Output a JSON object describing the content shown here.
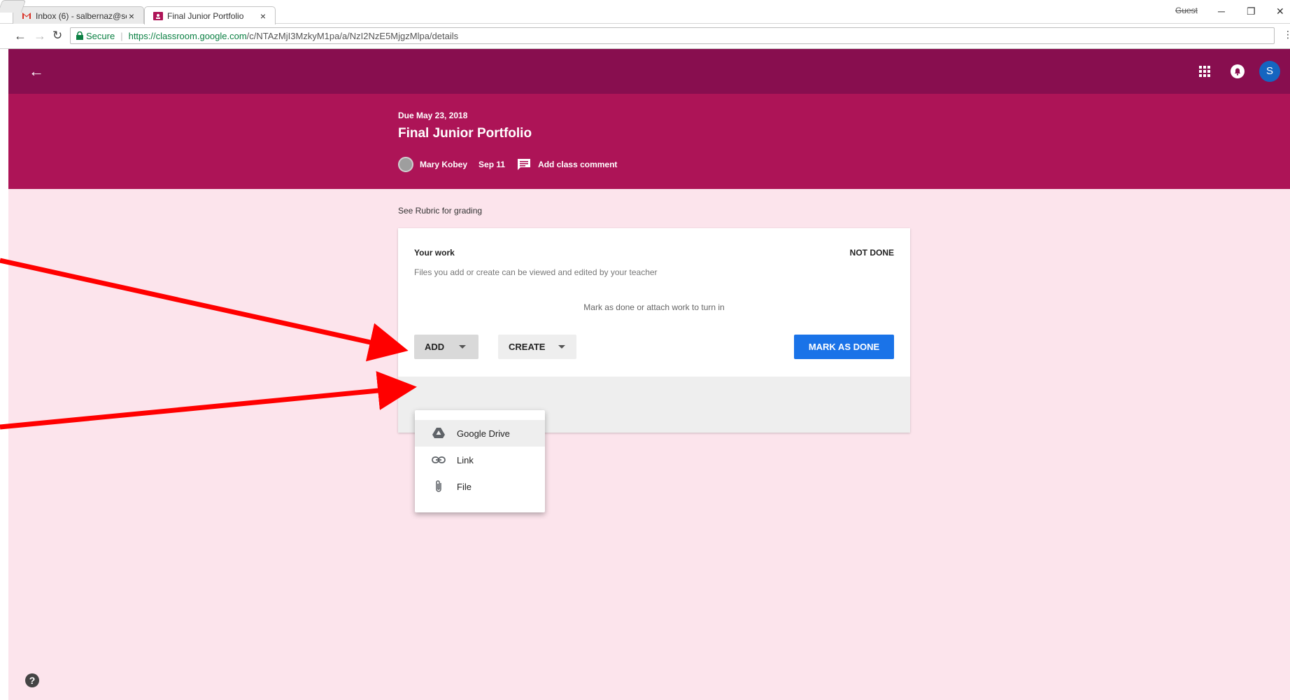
{
  "browser": {
    "tabs": [
      {
        "title": "Inbox (6) - salbernaz@se",
        "favicon": "gmail-icon",
        "active": false
      },
      {
        "title": "Final Junior Portfolio",
        "favicon": "classroom-icon",
        "active": true
      }
    ],
    "window_user": "Guest",
    "omnibox": {
      "secure_label": "Secure",
      "url_host": "https://classroom.google.com",
      "url_path": "/c/NTAzMjI3MzkyM1pa/a/NzI2NzE5MjgzMlpa/details"
    }
  },
  "appbar": {
    "avatar_letter": "S"
  },
  "assignment": {
    "due": "Due May 23, 2018",
    "title": "Final Junior Portfolio",
    "teacher": "Mary Kobey",
    "posted": "Sep 11",
    "comment_label": "Add class comment",
    "description": "See Rubric for grading"
  },
  "work": {
    "title": "Your work",
    "status": "NOT DONE",
    "subtitle": "Files you add or create can be viewed and edited by your teacher",
    "hint": "Mark as done or attach work to turn in",
    "add_label": "ADD",
    "create_label": "CREATE",
    "mark_done_label": "MARK AS DONE"
  },
  "add_menu": {
    "items": [
      {
        "label": "Google Drive",
        "icon": "google-drive-icon"
      },
      {
        "label": "Link",
        "icon": "link-icon"
      },
      {
        "label": "File",
        "icon": "paperclip-icon"
      }
    ]
  },
  "colors": {
    "appbar": "#880e4f",
    "hero": "#ad1457",
    "background": "#fce4ec",
    "primary_button": "#1a73e8",
    "annotation_arrow": "#ff0000"
  }
}
